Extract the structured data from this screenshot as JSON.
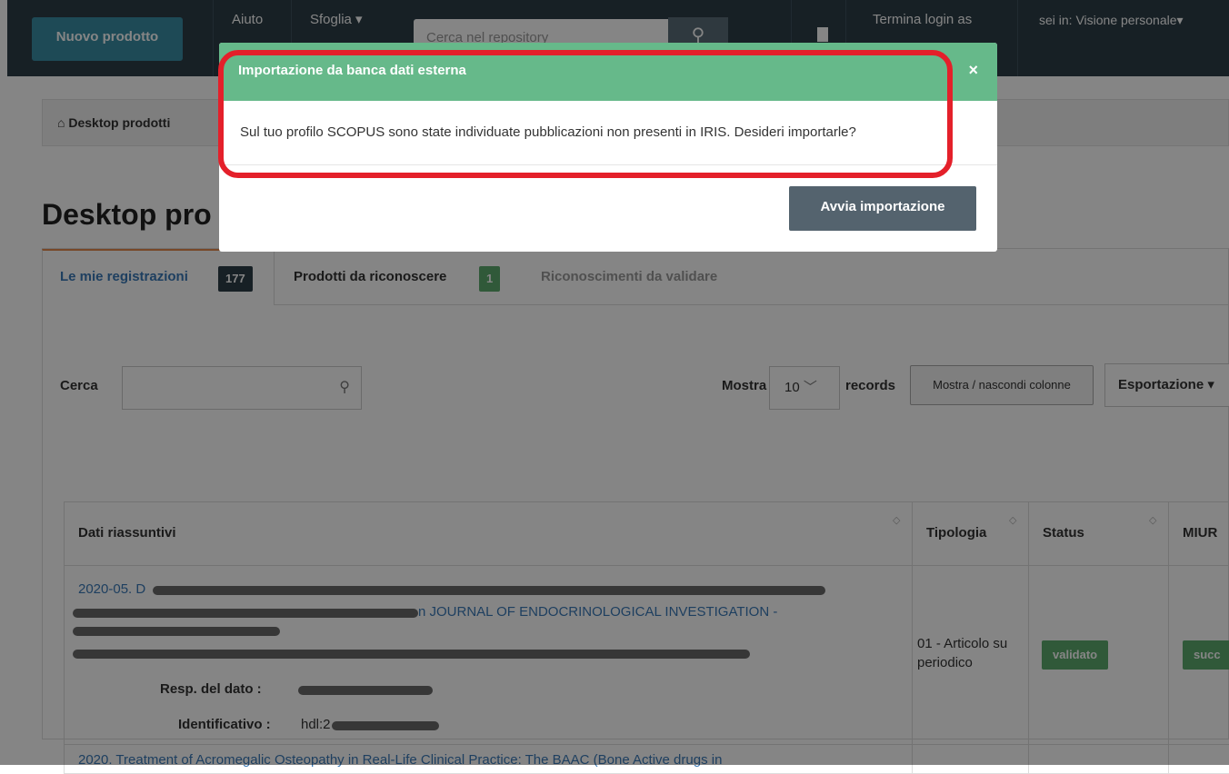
{
  "navbar": {
    "new_product": "Nuovo prodotto",
    "help": "Aiuto",
    "browse": "Sfoglia",
    "search_placeholder": "Cerca nel repository",
    "end_login": "Termina login as",
    "context": "sei in: Visione personale"
  },
  "breadcrumb": {
    "home": "Desktop prodotti"
  },
  "page": {
    "title": "Desktop pro"
  },
  "tabs": [
    {
      "label": "Le mie registrazioni",
      "count": "177",
      "color": "#2d3e48"
    },
    {
      "label": "Prodotti da riconoscere",
      "count": "1",
      "color": "#5cab6e"
    },
    {
      "label": "Riconoscimenti da validare"
    }
  ],
  "toolbar": {
    "search_label": "Cerca",
    "show_label": "Mostra",
    "page_size": "10",
    "records_label": "records",
    "columns_button": "Mostra / nascondi colonne",
    "export_button": "Esportazione"
  },
  "table": {
    "headers": [
      "Dati riassuntivi",
      "Tipologia",
      "Status",
      "MIUR"
    ],
    "rows": [
      {
        "prefix": "2020-05. D",
        "journal": "n JOURNAL OF ENDOCRINOLOGICAL INVESTIGATION -",
        "resp_label": "Resp. del dato :",
        "id_label": "Identificativo :",
        "id_value": "hdl:2",
        "type": "01 - Articolo su periodico",
        "status": "validato",
        "miur": "succ"
      },
      {
        "title": "2020. Treatment of Acromegalic Osteopathy in Real-Life Clinical Practice: The BAAC (Bone Active drugs in"
      }
    ]
  },
  "modal": {
    "title": "Importazione da banca dati esterna",
    "close": "×",
    "body": "Sul tuo profilo SCOPUS sono state individuate pubblicazioni non presenti in IRIS. Desideri importarle?",
    "primary_button": "Avvia importazione",
    "header_color": "#66b98a",
    "highlight_color": "#e4202a"
  }
}
